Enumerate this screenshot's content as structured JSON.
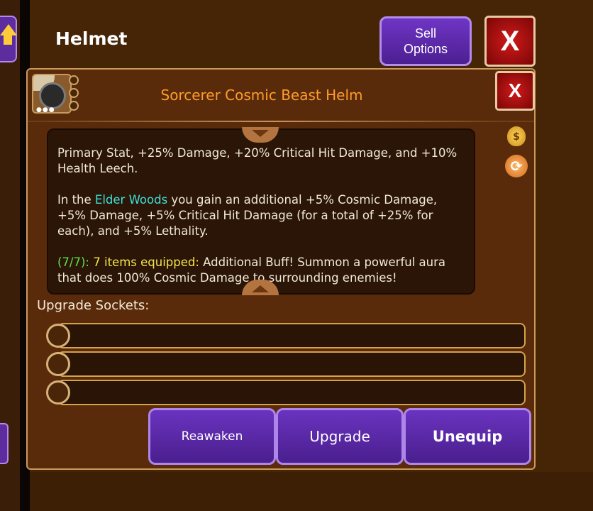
{
  "header": {
    "title": "Helmet",
    "sell_options_label": "Sell\nOptions",
    "close_label": "X"
  },
  "dialog": {
    "title": "Sorcerer Cosmic Beast Helm",
    "close_label": "X",
    "icon_dots": "●●●",
    "description": {
      "p1": "Primary Stat, +25% Damage, +20% Critical Hit Damage, and +10% Health Leech.",
      "p2_prefix": "In the ",
      "p2_location": "Elder Woods",
      "p2_suffix": " you gain an additional +5% Cosmic Damage, +5% Damage, +5% Critical Hit Damage (for a total of +25% for each), and +5% Lethality.",
      "p3_count": "(7/7):",
      "p3_equipped": " 7 items equipped:",
      "p3_suffix": " Additional Buff! Summon a powerful aura that does 100% Cosmic Damage to surrounding enemies!"
    },
    "sockets_label": "Upgrade Sockets:",
    "buttons": {
      "reawaken": "Reawaken",
      "upgrade": "Upgrade",
      "unequip": "Unequip"
    }
  },
  "colors": {
    "title_orange": "#ff9d2a",
    "location_cyan": "#3fe0d8",
    "set_green": "#5fe04a",
    "set_yellow": "#f4e34a",
    "button_purple": "#6a33bf",
    "close_red": "#d11a1a"
  }
}
